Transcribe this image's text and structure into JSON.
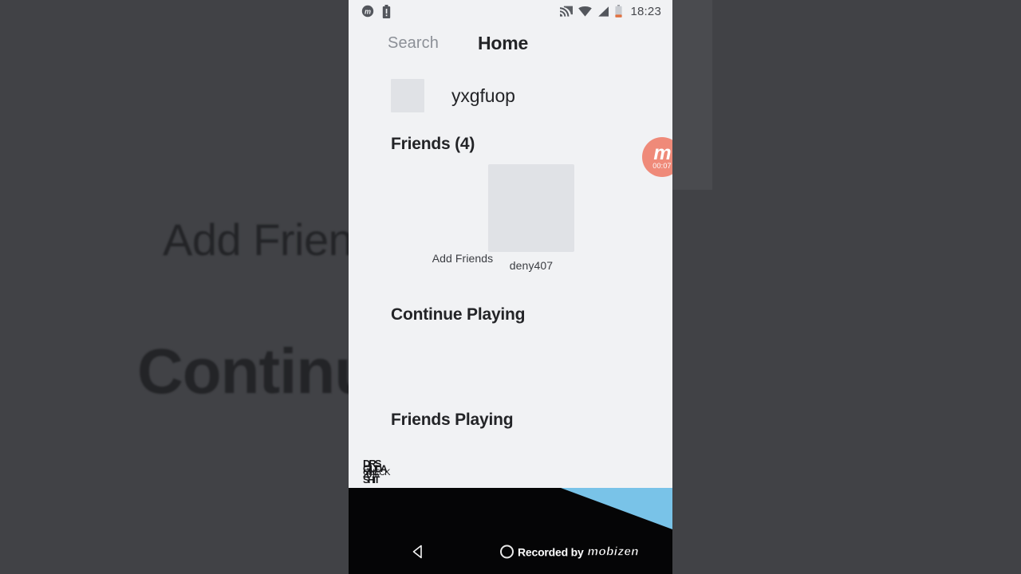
{
  "backdrop": {
    "color": "#414246",
    "blurred_texts": [
      {
        "id": "add",
        "text": "Add Friends"
      },
      {
        "id": "continue",
        "text": "Continu"
      }
    ]
  },
  "phone": {
    "background_color": "#f1f2f4",
    "status_bar": {
      "left_icons": [
        {
          "name": "mobizen-status-icon",
          "glyph": "m"
        },
        {
          "name": "battery-alert-icon",
          "glyph": "!"
        }
      ],
      "right_icons": [
        {
          "name": "cast-icon"
        },
        {
          "name": "wifi-icon"
        },
        {
          "name": "cellular-signal-icon"
        },
        {
          "name": "battery-low-icon"
        }
      ],
      "time": "18:23"
    },
    "app_bar": {
      "search_label": "Search",
      "title": "Home"
    },
    "user": {
      "name": "yxgfuop",
      "avatar_placeholder_color": "#e0e2e6"
    },
    "sections": {
      "friends": {
        "heading": "Friends (4)",
        "tiles": [
          {
            "label": "Add Friends",
            "name": "add-friends-tile"
          },
          {
            "label": "deny407",
            "name": "friend-tile-deny407"
          }
        ]
      },
      "continue_playing": {
        "heading": "Continue Playing"
      },
      "friends_playing": {
        "heading": "Friends Playing"
      }
    },
    "glitched_text": {
      "lines": [
        "DRS",
        "GIUDA",
        "SHIT",
        "CHECK",
        "20%"
      ]
    },
    "floating_widget": {
      "name": "mobizen-record-widget",
      "logo": "m",
      "timer": "00:07",
      "color": "#ef8a79"
    },
    "nav_bar": {
      "back_label": "Back",
      "watermark_text": "Recorded by",
      "watermark_logo": "mobizen"
    },
    "blue_wedge_color": "#79c3e8"
  }
}
